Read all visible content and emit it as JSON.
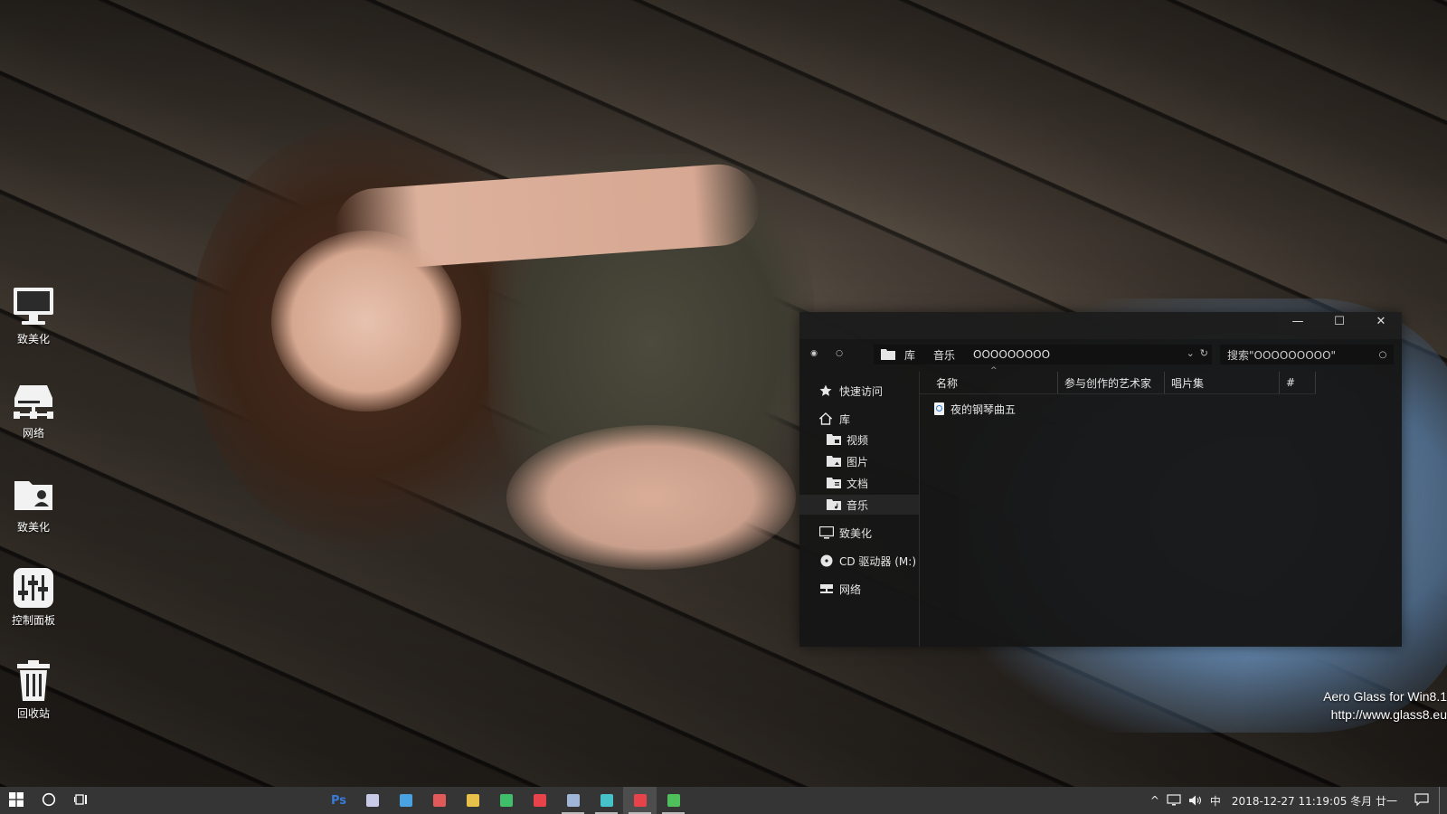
{
  "desktop": {
    "icons": [
      {
        "label": "致美化",
        "icon": "computer-icon"
      },
      {
        "label": "网络",
        "icon": "network-icon"
      },
      {
        "label": "致美化",
        "icon": "user-folder-icon"
      },
      {
        "label": "控制面板",
        "icon": "control-panel-icon"
      },
      {
        "label": "回收站",
        "icon": "recycle-bin-icon"
      }
    ],
    "watermark": {
      "line1": "Aero Glass for Win8.1",
      "line2": "http://www.glass8.eu"
    }
  },
  "explorer": {
    "window_buttons": {
      "minimize": "—",
      "maximize": "☐",
      "close": "✕"
    },
    "nav": {
      "back": "◉",
      "forward": "○"
    },
    "address": {
      "crumbs": [
        "库",
        "音乐",
        "OOOOOOOOO"
      ],
      "dropdown": "⌄",
      "refresh": "↻"
    },
    "search": {
      "placeholder": "搜索\"OOOOOOOOO\"",
      "icon": "○"
    },
    "sidebar": {
      "quick_access": "快速访问",
      "library": "库",
      "library_items": [
        "视频",
        "图片",
        "文档",
        "音乐"
      ],
      "selected": "音乐",
      "this_pc": "致美化",
      "cd_drive": "CD 驱动器 (M:)",
      "network": "网络"
    },
    "columns": [
      "名称",
      "参与创作的艺术家",
      "唱片集",
      "#"
    ],
    "sort_indicator": "^",
    "files": [
      {
        "name": "夜的钢琴曲五"
      }
    ]
  },
  "taskbar": {
    "apps": [
      {
        "name": "photoshop",
        "label": "Ps",
        "color": "#3a7bd5",
        "running": false
      },
      {
        "name": "rocket",
        "color": "#c9c9e8",
        "running": false
      },
      {
        "name": "windows-store",
        "color": "#4aa3e0",
        "running": false
      },
      {
        "name": "image-viewer",
        "color": "#e05a5a",
        "running": false
      },
      {
        "name": "fan",
        "color": "#e8c14a",
        "running": false
      },
      {
        "name": "recycle",
        "color": "#3fbf6a",
        "running": false
      },
      {
        "name": "video",
        "color": "#e8434a",
        "running": false
      },
      {
        "name": "notepad",
        "color": "#9fb6d9",
        "running": true
      },
      {
        "name": "camera",
        "color": "#46c3c9",
        "running": true
      },
      {
        "name": "remote-desktop",
        "color": "#e8434a",
        "running": true,
        "active": true
      },
      {
        "name": "chrome",
        "color": "#4fbf5c",
        "running": true
      }
    ],
    "tray": {
      "chevron": "^",
      "ime": "中",
      "clock": "2018-12-27  11:19:05  冬月 廿一"
    }
  }
}
